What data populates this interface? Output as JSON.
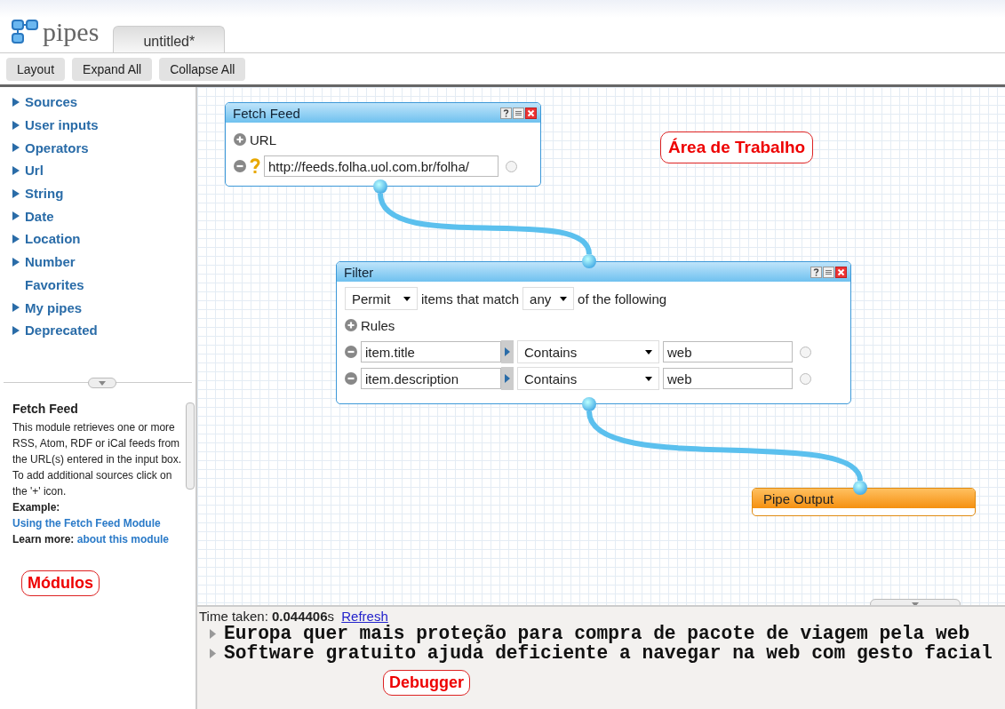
{
  "app": {
    "logo": "pipes"
  },
  "tabs": [
    {
      "label": "untitled*",
      "selected": true
    }
  ],
  "toolbar": [
    "Layout",
    "Expand All",
    "Collapse All"
  ],
  "sidebar": {
    "items": [
      {
        "label": "Sources",
        "expandable": true
      },
      {
        "label": "User inputs",
        "expandable": true
      },
      {
        "label": "Operators",
        "expandable": true
      },
      {
        "label": "Url",
        "expandable": true
      },
      {
        "label": "String",
        "expandable": true
      },
      {
        "label": "Date",
        "expandable": true
      },
      {
        "label": "Location",
        "expandable": true
      },
      {
        "label": "Number",
        "expandable": true
      },
      {
        "label": "Favorites",
        "expandable": false
      },
      {
        "label": "My pipes",
        "expandable": true
      },
      {
        "label": "Deprecated",
        "expandable": true
      }
    ],
    "help": {
      "title": "Fetch Feed",
      "text": "This module retrieves one or more RSS, Atom, RDF or iCal feeds from the URL(s) entered in the input box. To add additional sources click on the '+' icon.",
      "example_label": "Example:",
      "example_link": "Using the Fetch Feed Module",
      "learn_label": "Learn more:",
      "learn_link": "about this module"
    },
    "annotation": "Módulos"
  },
  "canvas": {
    "annotation": "Área de Trabalho",
    "fetch_feed": {
      "title": "Fetch Feed",
      "add_label": "URL",
      "url": "http://feeds.folha.uol.com.br/folha/"
    },
    "filter": {
      "title": "Filter",
      "mode": "Permit",
      "middle_text": "items that match",
      "match": "any",
      "end_text": "of the following",
      "rules_label": "Rules",
      "rules": [
        {
          "field": "item.title",
          "operator": "Contains",
          "value": "web"
        },
        {
          "field": "item.description",
          "operator": "Contains",
          "value": "web"
        }
      ]
    },
    "output": {
      "title": "Pipe Output"
    }
  },
  "debugger": {
    "time_label": "Time taken:",
    "time_value": "0.044406",
    "time_unit": "s",
    "refresh": "Refresh",
    "items": [
      "Europa quer mais proteção para compra de pacote de viagem pela web",
      "Software gratuito ajuda deficiente a navegar na web com gesto facial"
    ],
    "annotation": "Debugger"
  }
}
